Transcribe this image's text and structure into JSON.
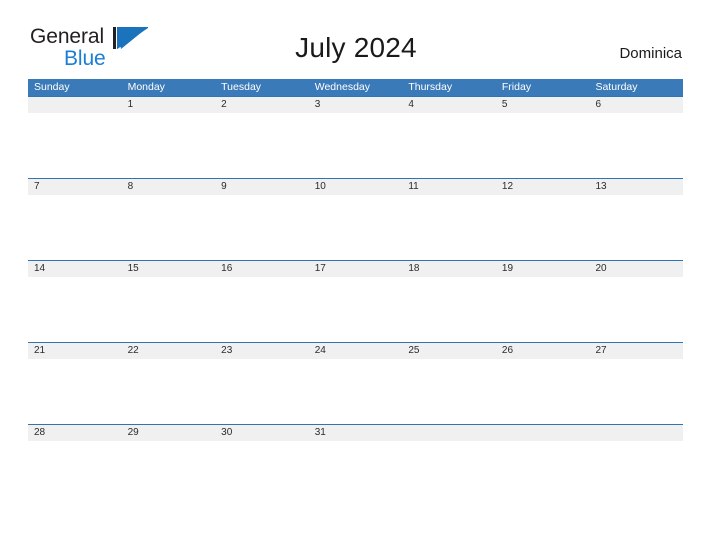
{
  "logo": {
    "word_one": "General",
    "word_two": "Blue",
    "triangle_icon": "triangle-icon",
    "colors": {
      "text": "#231f20",
      "blue": "#1a7fd4",
      "triangle": "#1b72bd"
    }
  },
  "header": {
    "title": "July 2024",
    "country": "Dominica"
  },
  "calendar": {
    "weekdays": [
      "Sunday",
      "Monday",
      "Tuesday",
      "Wednesday",
      "Thursday",
      "Friday",
      "Saturday"
    ],
    "colors": {
      "header_bg": "#3b7ab8",
      "header_text": "#ffffff",
      "row_band": "#f0f0f0",
      "row_border": "#2e75b6",
      "date_text": "#2b2b2b",
      "page_bg": "#ffffff"
    },
    "weeks": [
      {
        "days": [
          "",
          "1",
          "2",
          "3",
          "4",
          "5",
          "6"
        ]
      },
      {
        "days": [
          "7",
          "8",
          "9",
          "10",
          "11",
          "12",
          "13"
        ]
      },
      {
        "days": [
          "14",
          "15",
          "16",
          "17",
          "18",
          "19",
          "20"
        ]
      },
      {
        "days": [
          "21",
          "22",
          "23",
          "24",
          "25",
          "26",
          "27"
        ]
      },
      {
        "days": [
          "28",
          "29",
          "30",
          "31",
          "",
          "",
          ""
        ]
      }
    ]
  }
}
